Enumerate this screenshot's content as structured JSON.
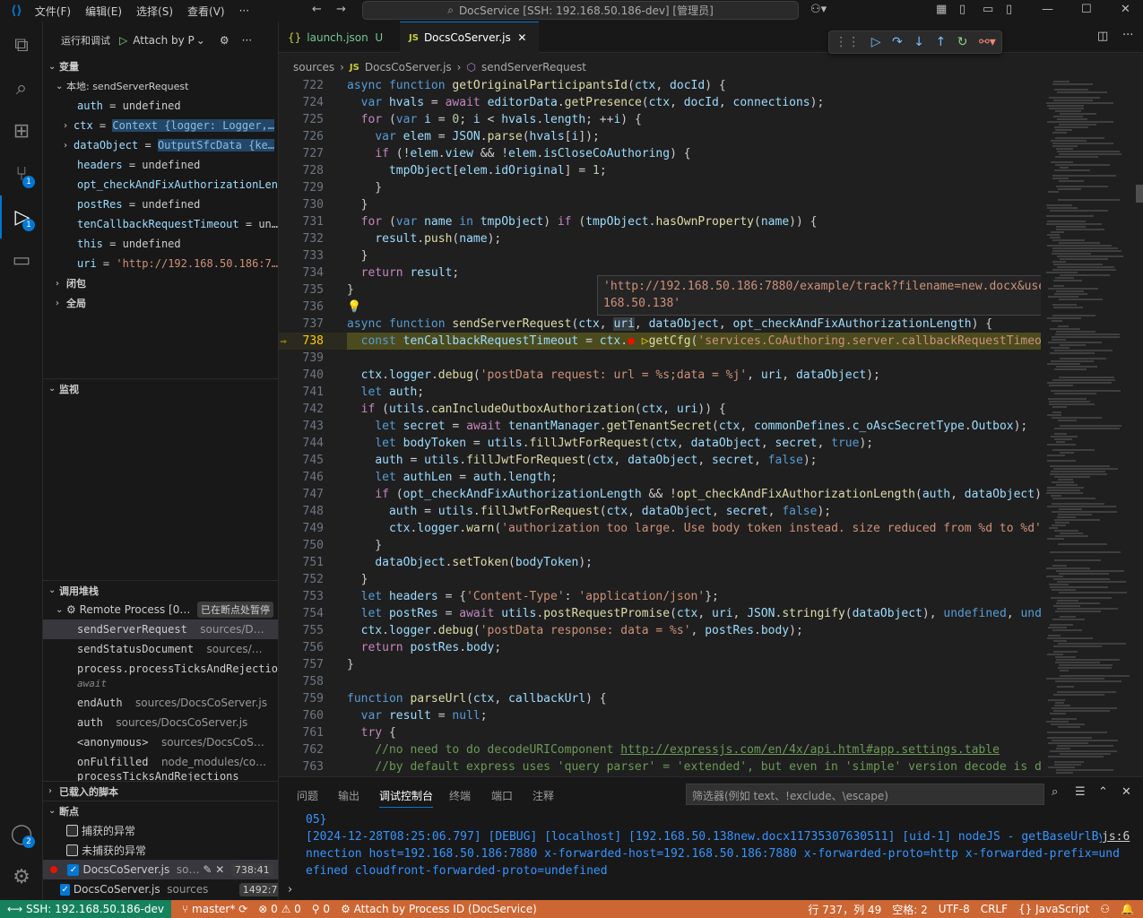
{
  "titlebar": {
    "menus": [
      "文件(F)",
      "编辑(E)",
      "选择(S)",
      "查看(V)",
      "···"
    ],
    "search": "DocService [SSH: 192.168.50.186-dev] [管理员]"
  },
  "activity": {
    "scm_badge": "1",
    "debug_badge": "1",
    "account_badge": "2"
  },
  "sidebar": {
    "run_title": "运行和调试",
    "config": "Attach by P",
    "variables_title": "变量",
    "local_scope": "本地: sendServerRequest",
    "vars": [
      {
        "name": "auth",
        "eq": "=",
        "value": "undefined"
      },
      {
        "name": "ctx",
        "eq": "=",
        "value": "Context {logger: Logger,…"
      },
      {
        "name": "dataObject",
        "eq": "=",
        "value": "OutputSfcData {ke…"
      },
      {
        "name": "headers",
        "eq": "=",
        "value": "undefined"
      },
      {
        "name": "opt_checkAndFixAuthorizationLeng",
        "eq": "",
        "value": ""
      },
      {
        "name": "postRes",
        "eq": "=",
        "value": "undefined"
      },
      {
        "name": "tenCallbackRequestTimeout",
        "eq": "=",
        "value": "un…"
      },
      {
        "name": "this",
        "eq": "=",
        "value": "undefined"
      },
      {
        "name": "uri",
        "eq": "=",
        "value": "'http://192.168.50.186:7…"
      }
    ],
    "closure": "闭包",
    "global": "全局",
    "watch_title": "监视",
    "callstack_title": "调用堆栈",
    "process": "Remote Process [0…",
    "paused": "已在断点处暂停",
    "stack": [
      {
        "fn": "sendServerRequest",
        "src": "sources/D…"
      },
      {
        "fn": "sendStatusDocument",
        "src": "sources/…"
      },
      {
        "fn": "process.processTicksAndRejection",
        "src": ""
      },
      {
        "fn": "await",
        "src": ""
      },
      {
        "fn": "endAuth",
        "src": "sources/DocsCoServer.js"
      },
      {
        "fn": "auth",
        "src": "sources/DocsCoServer.js"
      },
      {
        "fn": "<anonymous>",
        "src": "sources/DocsCoS…"
      },
      {
        "fn": "onFulfilled",
        "src": "node_modules/co…"
      },
      {
        "fn": "processTicksAndRejections",
        "src": ""
      }
    ],
    "loaded_scripts": "已载入的脚本",
    "breakpoints_title": "断点",
    "caught": "捕获的异常",
    "uncaught": "未捕获的异常",
    "bps": [
      {
        "file": "DocsCoServer.js",
        "dir": "so…",
        "pos": "738:41"
      },
      {
        "file": "DocsCoServer.js",
        "dir": "sources",
        "pos": "1492:7"
      }
    ]
  },
  "tabs": [
    {
      "label": "launch.json",
      "flag": "U",
      "icon": "{}"
    },
    {
      "label": "DocsCoServer.js",
      "icon": "JS"
    }
  ],
  "breadcrumb": [
    "sources",
    "DocsCoServer.js",
    "sendServerRequest"
  ],
  "hover": "'http://192.168.50.186:7880/example/track?filename=new.docx&useraddress=192.168.50.138'",
  "panel": {
    "tabs": [
      "问题",
      "输出",
      "调试控制台",
      "终端",
      "端口",
      "注释"
    ],
    "filter": "筛选器(例如 text、!exclude、\\escape)",
    "lines": [
      "05}",
      "[2024-12-28T08:25:06.797] [DEBUG] [localhost] [192.168.50.138new.docx11735307630511] [uid-1] nodeJS - getBaseUrlByCo…",
      "nnection host=192.168.50.186:7880 x-forwarded-host=192.168.50.186:7880 x-forwarded-proto=http x-forwarded-prefix=und",
      "efined cloudfront-forwarded-proto=undefined"
    ],
    "link": "js:6"
  },
  "status": {
    "remote": "SSH: 192.168.50.186-dev",
    "branch": "master*",
    "problems": "⊗ 0 ⚠ 0",
    "ports": "0",
    "debug": "Attach by Process ID (DocService)",
    "position": "行 737，列 49",
    "spaces": "空格: 2",
    "encoding": "UTF-8",
    "eol": "CRLF",
    "language": "JavaScript"
  }
}
